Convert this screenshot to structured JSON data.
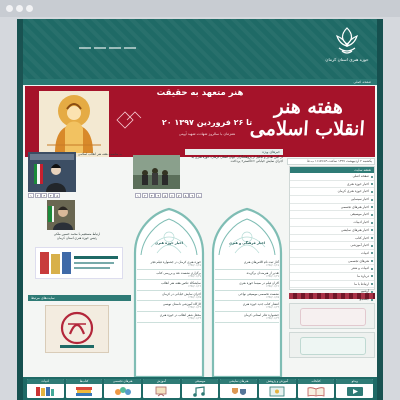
{
  "site": {
    "logo_text": "حوزه هنری استان کرمان",
    "nav_home": "صفحه اصلی"
  },
  "banner": {
    "headline": "هنر متعهد به حقیقت",
    "title_line1": "هفته هنر",
    "title_line2": "انقلاب اسلامی",
    "date": "۲۰ تا ۲۶ فروردین ۱۳۹۷",
    "subtitle": "همزمان با سالروز شهادت شهید آوینی"
  },
  "right": {
    "date_box": "یکشنبه ۲ اردیبهشت ۱۳۹۷ ساعت ۱۱:۵۷:۵۹ ب.ظ",
    "sitemap_head": "نقشه سایت",
    "items": [
      "صفحه اصلی",
      "اخبار حوزه هنری",
      "اخبار حوزه هنری کرمان",
      "اخبار سینمایی",
      "اخبار هنرهای تجسمی",
      "اخبار موسیقی",
      "اخبار ادبیات",
      "اخبار هنرهای نمایشی",
      "اخبار کتاب",
      "اخبار آموزشی",
      "ادبیات",
      "هنرهای تجسمی",
      "ادبیات و شعر",
      "درباره ما",
      "ارتباط با ما",
      "آرشیو",
      "جستجو"
    ]
  },
  "left": {
    "leader_text": "به مناسبت هفته هنر انقلاب اسلامی",
    "manager_caption_1": "ارتباط مستقیم با محمد حسین ملکی",
    "manager_caption_2": "رئیس حوزه هنری استان کرمان",
    "panel_head": "سایت‌های مرتبط",
    "pager": [
      "۱",
      "۲",
      "۳",
      "۴",
      "۵",
      "۶",
      "۷",
      "۸",
      "۹",
      "۱۰"
    ]
  },
  "middle": {
    "news_head": "خبرهای ویژه",
    "news_text": "در آئین تقدیر و تجلیل از پژوهشگران جوان استان کرمان، حوزه هنری به اجرای نمایش خیابانی «خاکستر» پرداخت",
    "news_pager": [
      "۱",
      "۲",
      "۳",
      "۴",
      "۵",
      "۶",
      "۷",
      "۸",
      "۹",
      "۱۰"
    ],
    "col_a_title": "اخبار حوزه هنری",
    "col_b_title": "اخبار فرهنگی و هنری",
    "col_a": [
      {
        "t": "حوزه هنری کرمان در جشنواره فیلم فجر",
        "d": "۱۳۹۷/۰۱/۲۸"
      },
      {
        "t": "برگزاری نشست نقد و بررسی کتاب",
        "d": "۱۳۹۷/۰۱/۲۷"
      },
      {
        "t": "نمایشگاه عکس هفته هنر انقلاب",
        "d": "۱۳۹۷/۰۱/۲۶"
      },
      {
        "t": "اجرای نمایش خیابانی در کرمان",
        "d": "۱۳۹۷/۰۱/۲۵"
      },
      {
        "t": "کارگاه آموزشی داستان نویسی",
        "d": "۱۳۹۷/۰۱/۲۴"
      },
      {
        "t": "محفل شعر انقلاب در حوزه هنری",
        "d": "۱۳۹۷/۰۱/۲۳"
      }
    ],
    "col_b": [
      {
        "t": "آغاز ثبت نام کلاس‌های هنری",
        "d": "۱۳۹۷/۰۱/۲۸"
      },
      {
        "t": "تقدیر از هنرمندان برگزیده",
        "d": "۱۳۹۷/۰۱/۲۷"
      },
      {
        "t": "اکران فیلم در سینما حوزه هنری",
        "d": "۱۳۹۷/۰۱/۲۶"
      },
      {
        "t": "نشست تخصصی موسیقی نواحی",
        "d": "۱۳۹۷/۰۱/۲۵"
      },
      {
        "t": "انتشار کتاب جدید حوزه هنری",
        "d": "۱۳۹۷/۰۱/۲۴"
      },
      {
        "t": "جشنواره تئاتر استانی کرمان",
        "d": "۱۳۹۷/۰۱/۲۳"
      }
    ]
  },
  "footer": {
    "tiles": [
      "ادبیات",
      "کتاب‌ها",
      "هنرهای تجسمی",
      "آموزش",
      "موسیقی",
      "هنرهای نمایشی",
      "آموزش و پژوهش",
      "کتابخانه",
      "ویدئو"
    ]
  },
  "colors": {
    "primary": "#1f6a66",
    "banner": "#a5132a",
    "accent": "#2e7b76"
  }
}
